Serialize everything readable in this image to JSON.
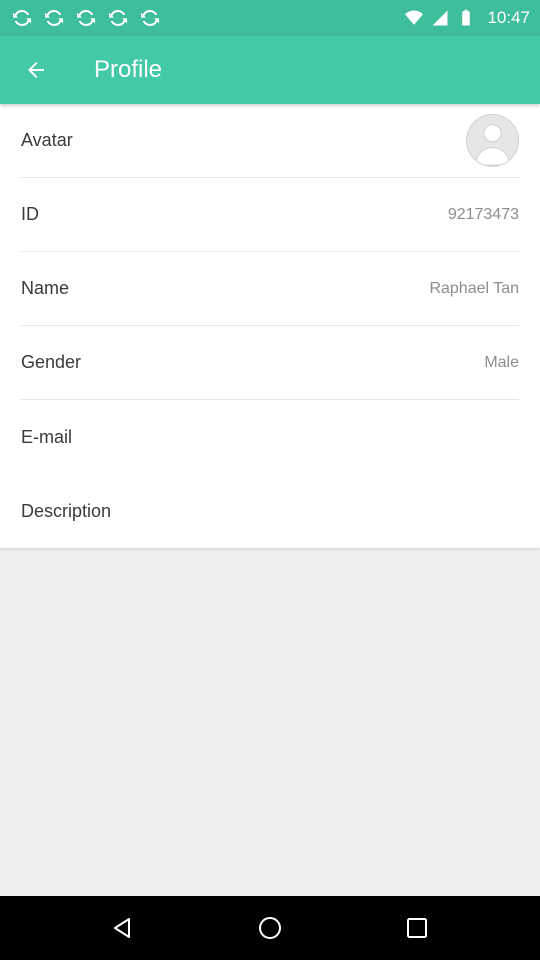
{
  "status_bar": {
    "time": "10:47",
    "icons": [
      "sync-icon",
      "sync-icon",
      "sync-icon",
      "sync-icon",
      "sync-icon",
      "wifi-icon",
      "signal-icon",
      "battery-icon"
    ]
  },
  "app_bar": {
    "title": "Profile",
    "back_icon": "arrow-left-icon"
  },
  "profile": {
    "avatar_label": "Avatar",
    "id_label": "ID",
    "id_value": "92173473",
    "name_label": "Name",
    "name_value": "Raphael Tan",
    "gender_label": "Gender",
    "gender_value": "Male",
    "email_label": "E-mail",
    "description_label": "Description"
  },
  "nav_bar": {
    "icons": [
      "back-triangle-icon",
      "home-circle-icon",
      "recents-square-icon"
    ]
  },
  "colors": {
    "status_bar": "#3fbe9b",
    "app_bar": "#43c9a6",
    "background": "#efefef"
  }
}
